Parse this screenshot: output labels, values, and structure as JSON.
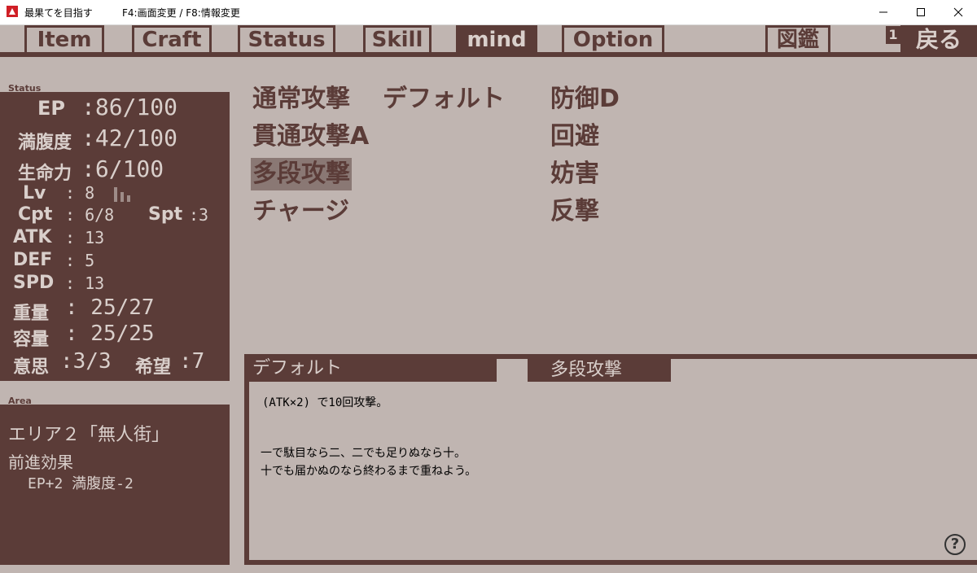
{
  "window": {
    "title": "最果てを目指す",
    "hint": "F4:画面変更 / F8:情報変更"
  },
  "tabs": [
    {
      "label": "Item",
      "active": false
    },
    {
      "label": "Craft",
      "active": false
    },
    {
      "label": "Status",
      "active": false
    },
    {
      "label": "Skill",
      "active": false
    },
    {
      "label": "mind",
      "active": true
    },
    {
      "label": "Option",
      "active": false
    },
    {
      "label": "図鑑",
      "active": false
    }
  ],
  "back": {
    "key": "1",
    "label": "戻る"
  },
  "status": {
    "section_label": "Status",
    "ep_key": "EP",
    "ep_val": ":86/100",
    "hunger_key": "満腹度",
    "hunger_val": ":42/100",
    "life_key": "生命力",
    "life_val": ":6/100",
    "lv_key": "Lv",
    "lv_val": ":  8",
    "cpt_key": "Cpt",
    "cpt_val": ":  6/8",
    "spt_key": "Spt",
    "spt_val": ":3",
    "atk_key": "ATK",
    "atk_val": ":  13",
    "def_key": "DEF",
    "def_val": ":  5",
    "spd_key": "SPD",
    "spd_val": ":  13",
    "weight_key": "重量",
    "weight_val": ":  25/27",
    "capacity_key": "容量",
    "capacity_val": ":  25/25",
    "will_key": "意思",
    "will_val": ":3/3",
    "hope_key": "希望",
    "hope_val": ":7"
  },
  "area": {
    "section_label": "Area",
    "name": "エリア２「無人街」",
    "effect_label": "前進効果",
    "effect_value": "EP+2  満腹度-2"
  },
  "skills": {
    "col1": [
      "通常攻撃",
      "貫通攻撃A",
      "多段攻撃",
      "チャージ"
    ],
    "col1_default": "デフォルト",
    "col2": [
      "防御D",
      "回避",
      "妨害",
      "反撃"
    ],
    "selected": "多段攻撃"
  },
  "description": {
    "tab_left": "デフォルト",
    "tab_right": "多段攻撃",
    "line1": "(ATK×2) で10回攻撃。",
    "line2": "一で駄目なら二、二でも足りぬなら十。",
    "line3": "十でも届かぬのなら終わるまで重ねよう。"
  },
  "help": {
    "label": "?"
  }
}
